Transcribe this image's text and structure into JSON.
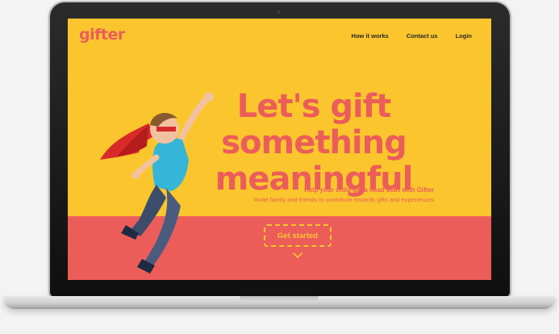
{
  "site": {
    "logo": "gifter",
    "nav": [
      {
        "label": "How it works"
      },
      {
        "label": "Contact us"
      },
      {
        "label": "Login"
      }
    ]
  },
  "hero": {
    "title_lines": [
      "Let's gift",
      "something",
      "meaningful"
    ],
    "subtitle": "Help your child get a head start with Gifter",
    "description": "Invite family and friends to contribute towards gifts and experiences",
    "cta_label": "Get started"
  },
  "colors": {
    "yellow": "#fbc62d",
    "coral": "#ec5d5a",
    "dark": "#262626"
  },
  "icons": {
    "scroll": "chevron-down-icon"
  }
}
